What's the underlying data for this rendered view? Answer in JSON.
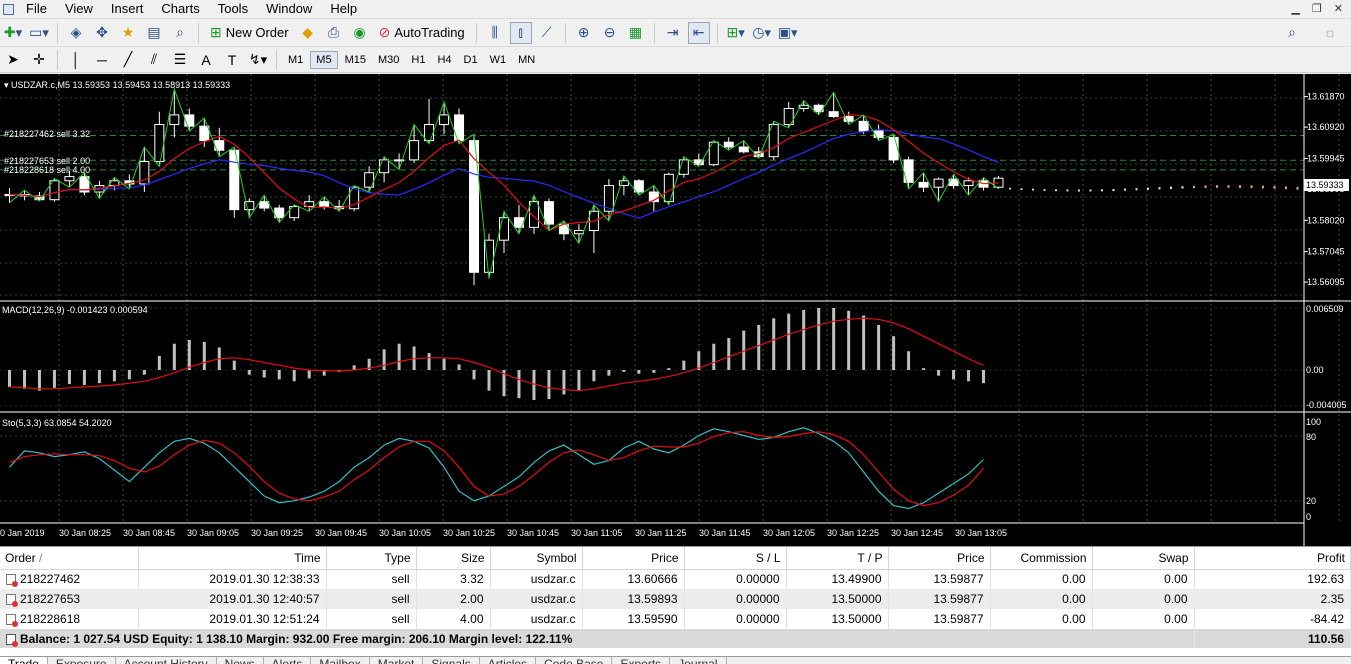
{
  "menu": {
    "items": [
      "File",
      "View",
      "Insert",
      "Charts",
      "Tools",
      "Window",
      "Help"
    ]
  },
  "toolbar": {
    "new_order": "New Order",
    "autotrading": "AutoTrading"
  },
  "timeframes": {
    "items": [
      "M1",
      "M5",
      "M15",
      "M30",
      "H1",
      "H4",
      "D1",
      "W1",
      "MN"
    ],
    "active": "M5"
  },
  "chart": {
    "header": "USDZAR.c,M5  13.59353 13.59453 13.58913 13.59333",
    "price_ticks": [
      "13.61870",
      "13.60920",
      "13.59945",
      "13.58995",
      "13.58020",
      "13.57045",
      "13.56095"
    ],
    "current_price": "13.59333",
    "order_lines": [
      "#218227462 sell 3.32",
      "#218227653 sell 2.00",
      "#218228618 sell 4.00"
    ],
    "macd_label": "MACD(12,26,9) -0.001423 0.000594",
    "macd_ticks": [
      "0.006509",
      "0.00",
      "-0.004005"
    ],
    "sto_label": "Sto(5,3,3) 63.0854 54.2020",
    "sto_ticks": [
      "100",
      "80",
      "20",
      "0"
    ],
    "time_ticks": [
      "0 Jan 2019",
      "30 Jan 08:25",
      "30 Jan 08:45",
      "30 Jan 09:05",
      "30 Jan 09:25",
      "30 Jan 09:45",
      "30 Jan 10:05",
      "30 Jan 10:25",
      "30 Jan 10:45",
      "30 Jan 11:05",
      "30 Jan 11:25",
      "30 Jan 11:45",
      "30 Jan 12:05",
      "30 Jan 12:25",
      "30 Jan 12:45",
      "30 Jan 13:05"
    ]
  },
  "chart_data": {
    "type": "candlestick",
    "symbol": "USDZAR.c",
    "timeframe": "M5",
    "ylim": [
      13.556,
      13.622
    ],
    "candles": [
      [
        13.588,
        13.5902,
        13.5856,
        13.5882
      ],
      [
        13.5882,
        13.5896,
        13.5864,
        13.5878
      ],
      [
        13.5878,
        13.589,
        13.5862,
        13.5866
      ],
      [
        13.5866,
        13.5932,
        13.586,
        13.5925
      ],
      [
        13.5925,
        13.5955,
        13.5905,
        13.5938
      ],
      [
        13.5938,
        13.595,
        13.588,
        13.589
      ],
      [
        13.589,
        13.5925,
        13.587,
        13.591
      ],
      [
        13.591,
        13.5935,
        13.5895,
        13.5925
      ],
      [
        13.5925,
        13.5945,
        13.59,
        13.5915
      ],
      [
        13.5915,
        13.603,
        13.589,
        13.5985
      ],
      [
        13.5985,
        13.614,
        13.597,
        13.61
      ],
      [
        13.61,
        13.621,
        13.606,
        13.613
      ],
      [
        13.613,
        13.615,
        13.608,
        13.6095
      ],
      [
        13.6095,
        13.612,
        13.603,
        13.605
      ],
      [
        13.605,
        13.609,
        13.6,
        13.602
      ],
      [
        13.602,
        13.603,
        13.581,
        13.5835
      ],
      [
        13.5835,
        13.587,
        13.581,
        13.586
      ],
      [
        13.586,
        13.588,
        13.583,
        13.584
      ],
      [
        13.584,
        13.585,
        13.5795,
        13.581
      ],
      [
        13.581,
        13.585,
        13.58,
        13.5845
      ],
      [
        13.5845,
        13.588,
        13.583,
        13.586
      ],
      [
        13.586,
        13.5875,
        13.5835,
        13.5845
      ],
      [
        13.5845,
        13.5865,
        13.583,
        13.5838
      ],
      [
        13.5838,
        13.591,
        13.583,
        13.5905
      ],
      [
        13.5905,
        13.597,
        13.589,
        13.595
      ],
      [
        13.595,
        13.6,
        13.592,
        13.599
      ],
      [
        13.599,
        13.601,
        13.596,
        13.599
      ],
      [
        13.599,
        13.61,
        13.598,
        13.605
      ],
      [
        13.605,
        13.618,
        13.604,
        13.61
      ],
      [
        13.61,
        13.617,
        13.607,
        13.613
      ],
      [
        13.613,
        13.615,
        13.604,
        13.605
      ],
      [
        13.605,
        13.607,
        13.56,
        13.564
      ],
      [
        13.564,
        13.576,
        13.562,
        13.574
      ],
      [
        13.574,
        13.583,
        13.57,
        13.581
      ],
      [
        13.581,
        13.585,
        13.576,
        13.578
      ],
      [
        13.578,
        13.588,
        13.576,
        13.586
      ],
      [
        13.586,
        13.587,
        13.577,
        13.579
      ],
      [
        13.579,
        13.58,
        13.574,
        13.576
      ],
      [
        13.576,
        13.579,
        13.573,
        13.577
      ],
      [
        13.577,
        13.585,
        13.57,
        13.583
      ],
      [
        13.583,
        13.593,
        13.58,
        13.591
      ],
      [
        13.591,
        13.594,
        13.588,
        13.5925
      ],
      [
        13.5925,
        13.593,
        13.588,
        13.589
      ],
      [
        13.589,
        13.591,
        13.583,
        13.586
      ],
      [
        13.586,
        13.595,
        13.585,
        13.5945
      ],
      [
        13.5945,
        13.6,
        13.5935,
        13.599
      ],
      [
        13.599,
        13.601,
        13.597,
        13.5975
      ],
      [
        13.5975,
        13.605,
        13.597,
        13.6045
      ],
      [
        13.6045,
        13.606,
        13.602,
        13.603
      ],
      [
        13.603,
        13.605,
        13.601,
        13.6015
      ],
      [
        13.6015,
        13.603,
        13.5995,
        13.6
      ],
      [
        13.6,
        13.611,
        13.599,
        13.61
      ],
      [
        13.61,
        13.617,
        13.609,
        13.615
      ],
      [
        13.615,
        13.6175,
        13.614,
        13.616
      ],
      [
        13.616,
        13.6165,
        13.613,
        13.614
      ],
      [
        13.614,
        13.62,
        13.612,
        13.6125
      ],
      [
        13.6125,
        13.614,
        13.61,
        13.611
      ],
      [
        13.611,
        13.613,
        13.607,
        13.608
      ],
      [
        13.608,
        13.61,
        13.605,
        13.606
      ],
      [
        13.606,
        13.607,
        13.598,
        13.599
      ],
      [
        13.599,
        13.6,
        13.59,
        13.592
      ],
      [
        13.592,
        13.595,
        13.589,
        13.5905
      ],
      [
        13.5905,
        13.5935,
        13.586,
        13.593
      ],
      [
        13.593,
        13.5945,
        13.59,
        13.591
      ],
      [
        13.591,
        13.5935,
        13.588,
        13.5925
      ],
      [
        13.5925,
        13.5935,
        13.5895,
        13.5905
      ],
      [
        13.5905,
        13.594,
        13.59,
        13.5933
      ]
    ],
    "macd_hist": [
      -0.0018,
      -0.002,
      -0.0022,
      -0.0019,
      -0.0015,
      -0.0016,
      -0.0014,
      -0.0012,
      -0.001,
      -0.0005,
      0.0015,
      0.0028,
      0.0032,
      0.003,
      0.0024,
      0.001,
      -0.0005,
      -0.0008,
      -0.001,
      -0.0012,
      -0.0009,
      -0.0006,
      -0.0002,
      0.0005,
      0.0012,
      0.0022,
      0.0028,
      0.0025,
      0.0018,
      0.0012,
      0.0006,
      -0.001,
      -0.0022,
      -0.0028,
      -0.003,
      -0.0032,
      -0.0031,
      -0.0026,
      -0.0022,
      -0.0012,
      -0.0006,
      -0.0002,
      -0.0004,
      -0.0003,
      0.0002,
      0.001,
      0.002,
      0.0028,
      0.0034,
      0.0042,
      0.0048,
      0.0055,
      0.006,
      0.0064,
      0.0066,
      0.0066,
      0.0063,
      0.0058,
      0.0048,
      0.0036,
      0.002,
      0.0002,
      -0.0006,
      -0.001,
      -0.0012,
      -0.0014
    ],
    "macd_signal": [
      -0.0018,
      -0.0019,
      -0.002,
      -0.002,
      -0.0019,
      -0.0018,
      -0.0017,
      -0.0016,
      -0.0014,
      -0.0012,
      -0.0008,
      -0.0003,
      0.0003,
      0.0008,
      0.0012,
      0.0013,
      0.0011,
      0.0008,
      0.0005,
      0.0002,
      0.0,
      -0.0001,
      -0.0001,
      0.0,
      0.0002,
      0.0005,
      0.0009,
      0.0012,
      0.0013,
      0.0013,
      0.0012,
      0.0008,
      0.0003,
      -0.0004,
      -0.001,
      -0.0015,
      -0.0019,
      -0.0021,
      -0.0022,
      -0.002,
      -0.0017,
      -0.0014,
      -0.0012,
      -0.001,
      -0.0007,
      -0.0003,
      0.0002,
      0.0008,
      0.0014,
      0.002,
      0.0026,
      0.0032,
      0.0038,
      0.0043,
      0.0048,
      0.0052,
      0.0054,
      0.0055,
      0.0054,
      0.005,
      0.0044,
      0.0036,
      0.0028,
      0.002,
      0.0012,
      0.0005
    ],
    "sto_main": [
      55,
      72,
      70,
      66,
      68,
      71,
      64,
      52,
      40,
      55,
      70,
      82,
      85,
      80,
      70,
      55,
      40,
      25,
      18,
      20,
      24,
      30,
      40,
      55,
      65,
      78,
      85,
      82,
      75,
      55,
      30,
      20,
      25,
      35,
      45,
      60,
      72,
      78,
      68,
      58,
      62,
      75,
      82,
      74,
      70,
      78,
      88,
      95,
      92,
      88,
      84,
      86,
      92,
      96,
      90,
      82,
      70,
      50,
      30,
      15,
      12,
      18,
      28,
      38,
      48,
      63
    ],
    "sto_signal": [
      60,
      66,
      68,
      69,
      68,
      68,
      67,
      62,
      54,
      50,
      56,
      68,
      78,
      83,
      80,
      70,
      56,
      40,
      28,
      22,
      20,
      24,
      30,
      42,
      52,
      65,
      76,
      82,
      82,
      72,
      55,
      35,
      25,
      27,
      35,
      47,
      60,
      70,
      73,
      68,
      62,
      65,
      72,
      77,
      76,
      76,
      80,
      87,
      91,
      92,
      88,
      86,
      87,
      90,
      92,
      89,
      82,
      68,
      50,
      32,
      20,
      15,
      18,
      26,
      36,
      54
    ]
  },
  "terminal": {
    "columns": [
      "Order",
      "Time",
      "Type",
      "Size",
      "Symbol",
      "Price",
      "S / L",
      "T / P",
      "Price",
      "Commission",
      "Swap",
      "Profit"
    ],
    "rows": [
      [
        "218227462",
        "2019.01.30 12:38:33",
        "sell",
        "3.32",
        "usdzar.c",
        "13.60666",
        "0.00000",
        "13.49900",
        "13.59877",
        "0.00",
        "0.00",
        "192.63"
      ],
      [
        "218227653",
        "2019.01.30 12:40:57",
        "sell",
        "2.00",
        "usdzar.c",
        "13.59893",
        "0.00000",
        "13.50000",
        "13.59877",
        "0.00",
        "0.00",
        "2.35"
      ],
      [
        "218228618",
        "2019.01.30 12:51:24",
        "sell",
        "4.00",
        "usdzar.c",
        "13.59590",
        "0.00000",
        "13.50000",
        "13.59877",
        "0.00",
        "0.00",
        "-84.42"
      ]
    ],
    "balance_line": "Balance: 1 027.54 USD  Equity: 1 138.10  Margin: 932.00  Free margin: 206.10  Margin level: 122.11%",
    "total_profit": "110.56",
    "tabs": [
      "Trade",
      "Exposure",
      "Account History",
      "News",
      "Alerts",
      "Mailbox",
      "Market",
      "Signals",
      "Articles",
      "Code Base",
      "Experts",
      "Journal"
    ]
  }
}
